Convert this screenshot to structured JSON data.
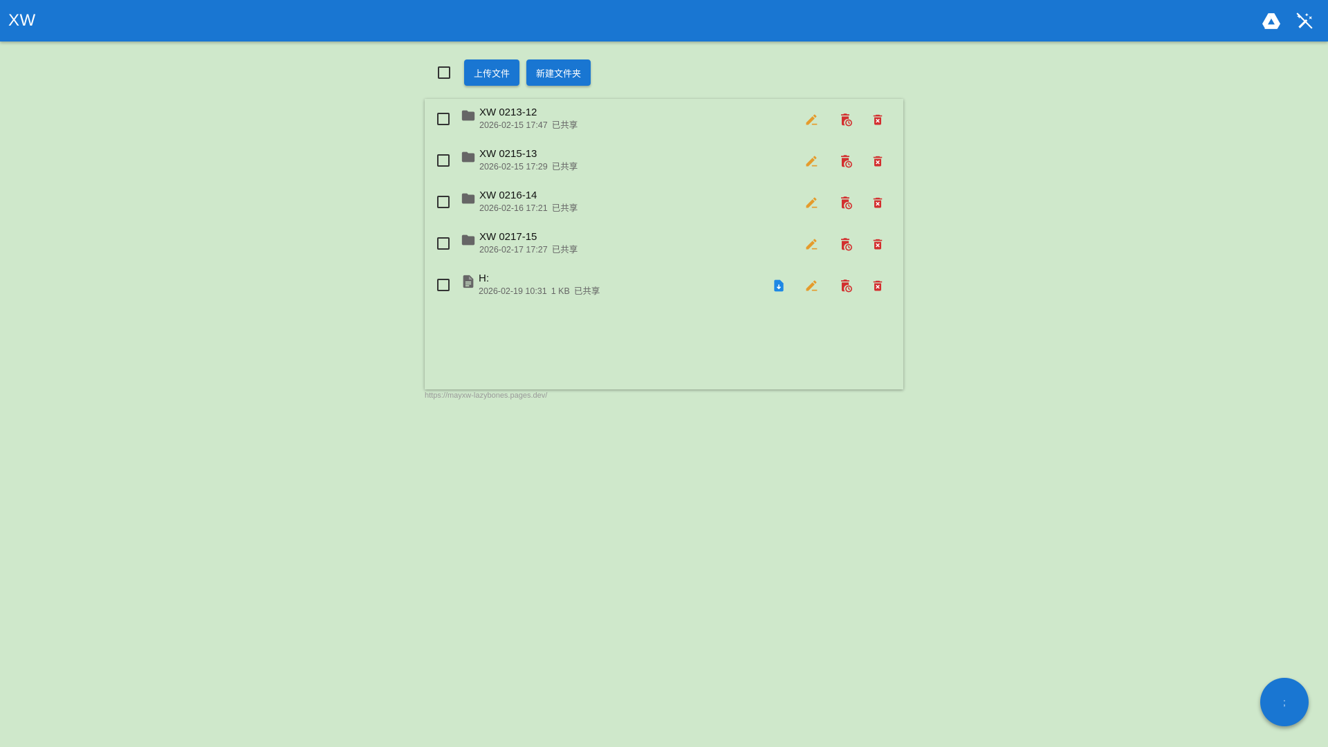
{
  "app": {
    "title": "XW",
    "colors": {
      "primary": "#1976d2",
      "background": "#cfe8cb",
      "edit": "#e59b2c",
      "delete": "#d32f2f",
      "download": "#1e88e5"
    },
    "header_icons": [
      "drive-icon",
      "auto-fix-off-icon"
    ]
  },
  "toolbar": {
    "upload_label": "上传文件",
    "new_folder_label": "新建文件夹"
  },
  "items": [
    {
      "type": "folder",
      "name": "XW 0213-12",
      "date": "2026-02-15 17:47",
      "size": "",
      "status": "已共享"
    },
    {
      "type": "folder",
      "name": "XW 0215-13",
      "date": "2026-02-15 17:29",
      "size": "",
      "status": "已共享"
    },
    {
      "type": "folder",
      "name": "XW 0216-14",
      "date": "2026-02-16 17:21",
      "size": "",
      "status": "已共享"
    },
    {
      "type": "folder",
      "name": "XW 0217-15",
      "date": "2026-02-17 17:27",
      "size": "",
      "status": "已共享"
    },
    {
      "type": "file",
      "name": "H:",
      "date": "2026-02-19 10:31",
      "size": "1 KB",
      "status": "已共享"
    }
  ],
  "footer": {
    "url": "https://mayxw-lazybones.pages.dev/"
  },
  "fab": {
    "label": ";"
  }
}
